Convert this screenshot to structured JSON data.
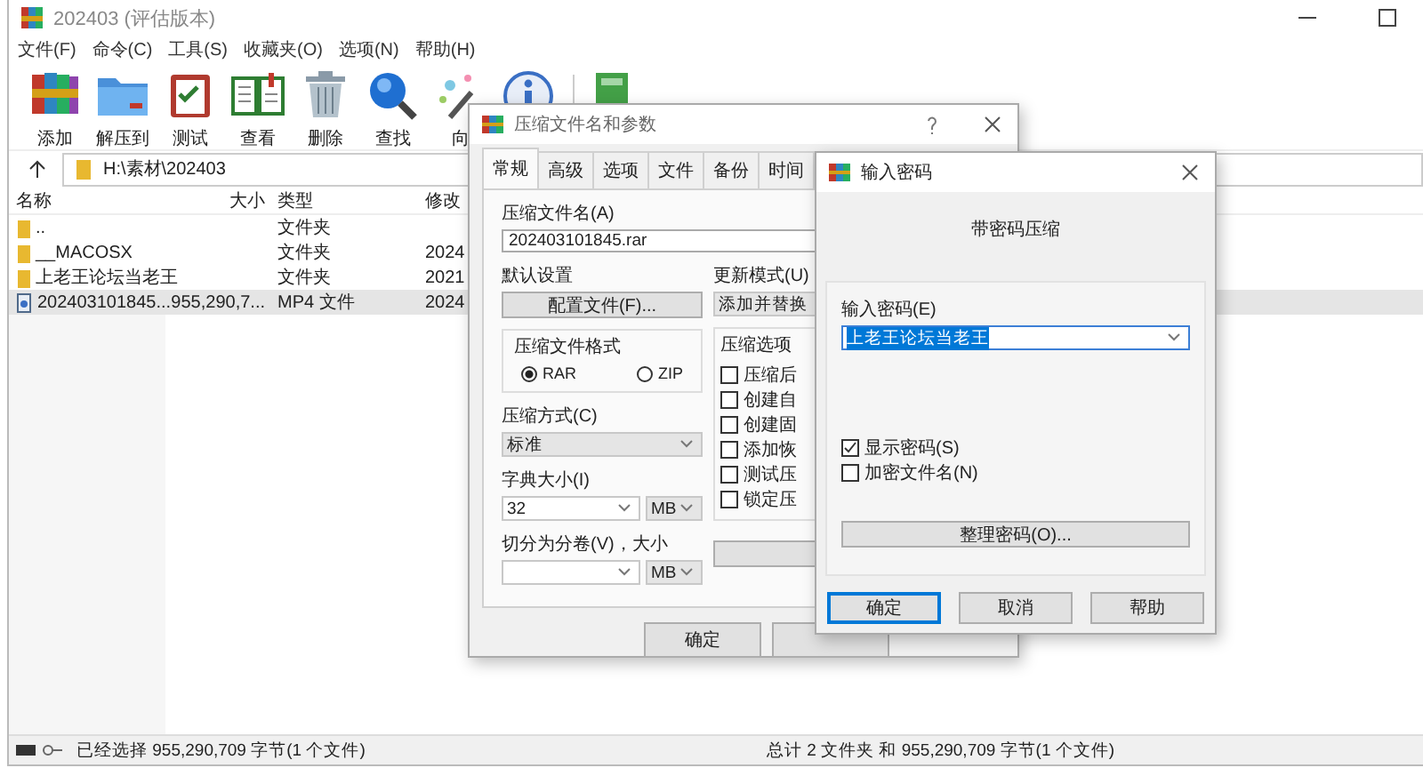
{
  "main_window": {
    "title": "202403 (评估版本)",
    "menu": [
      "文件(F)",
      "命令(C)",
      "工具(S)",
      "收藏夹(O)",
      "选项(N)",
      "帮助(H)"
    ],
    "toolbar": [
      {
        "kind": "books",
        "label": "添加"
      },
      {
        "kind": "folder",
        "label": "解压到"
      },
      {
        "kind": "clipboard",
        "label": "测试"
      },
      {
        "kind": "book",
        "label": "查看"
      },
      {
        "kind": "trash",
        "label": "删除"
      },
      {
        "kind": "magnifier",
        "label": "查找"
      },
      {
        "kind": "wand",
        "label": "向"
      },
      {
        "kind": "info"
      },
      {
        "kind": "greenbook"
      }
    ],
    "address": "H:\\素材\\202403",
    "columns": [
      "名称",
      "大小",
      "类型",
      "修改"
    ],
    "rows": [
      {
        "kind": "folder",
        "name": "..",
        "type": "文件夹",
        "selected": false
      },
      {
        "kind": "folder",
        "name": "__MACOSX",
        "type": "文件夹",
        "modified": "2024",
        "selected": false
      },
      {
        "kind": "folder",
        "name": "上老王论坛当老王",
        "type": "文件夹",
        "modified": "2021",
        "selected": false
      },
      {
        "kind": "file",
        "name": "202403101845...",
        "size": "955,290,7...",
        "type": "MP4 文件",
        "modified": "2024",
        "selected": true
      }
    ],
    "status_bar": {
      "left": "已经选择 955,290,709 字节(1 个文件)",
      "right": "总计 2 文件夹 和 955,290,709 字节(1 个文件)"
    }
  },
  "archive_dialog": {
    "title": "压缩文件名和参数",
    "tabs": [
      {
        "label": "常规",
        "selected": true
      },
      {
        "label": "高级",
        "selected": false
      },
      {
        "label": "选项",
        "selected": false
      },
      {
        "label": "文件",
        "selected": false
      },
      {
        "label": "备份",
        "selected": false
      },
      {
        "label": "时间",
        "selected": false
      }
    ],
    "archive_name_label": "压缩文件名(A)",
    "archive_name": "202403101845.rar",
    "defaults_label": "默认设置",
    "profiles_button": "配置文件(F)...",
    "format_group": {
      "title": "压缩文件格式",
      "options": [
        {
          "label": "RAR",
          "selected": true
        },
        {
          "label": "ZIP",
          "selected": false
        }
      ]
    },
    "method_label": "压缩方式(C)",
    "method": "标准",
    "dict_label": "字典大小(I)",
    "dict_size": "32",
    "dict_unit": "MB",
    "split_label": "切分为分卷(V)，大小",
    "split_unit": "MB",
    "update_mode_label": "更新模式(U)",
    "update_mode": "添加并替换",
    "options_group": {
      "title": "压缩选项",
      "items": [
        {
          "label": "压缩后",
          "checked": false
        },
        {
          "label": "创建自",
          "checked": false
        },
        {
          "label": "创建固",
          "checked": false
        },
        {
          "label": "添加恢",
          "checked": false
        },
        {
          "label": "测试压",
          "checked": false
        },
        {
          "label": "锁定压",
          "checked": false
        }
      ]
    },
    "ok_button": "确定"
  },
  "password_dialog": {
    "title": "输入密码",
    "heading": "带密码压缩",
    "password_label": "输入密码(E)",
    "password": "上老王论坛当老王",
    "password_highlighted": true,
    "options": [
      {
        "label": "显示密码(S)",
        "checked": true
      },
      {
        "label": "加密文件名(N)",
        "checked": false
      }
    ],
    "organize_button": "整理密码(O)...",
    "buttons": [
      {
        "label": "确定",
        "default": true
      },
      {
        "label": "取消",
        "default": false
      },
      {
        "label": "帮助",
        "default": false
      }
    ]
  }
}
